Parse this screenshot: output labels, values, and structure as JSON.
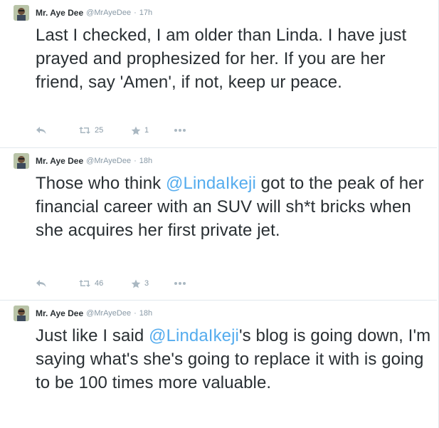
{
  "tweets": [
    {
      "author": {
        "name": "Mr. Aye Dee",
        "handle": "@MrAyeDee"
      },
      "separator": "·",
      "time": "17h",
      "text": "Last I checked, I am older than Linda. I have just prayed and prophesized for her. If you are her friend, say 'Amen', if not, keep ur peace.",
      "retweets": "25",
      "favorites": "1"
    },
    {
      "author": {
        "name": "Mr. Aye Dee",
        "handle": "@MrAyeDee"
      },
      "separator": "·",
      "time": "18h",
      "text_before": "Those who think ",
      "mention": "@LindaIkeji",
      "text_after": " got to the peak of her financial career with an SUV will sh*t bricks when she acquires her first private jet.",
      "retweets": "46",
      "favorites": "3"
    },
    {
      "author": {
        "name": "Mr. Aye Dee",
        "handle": "@MrAyeDee"
      },
      "separator": "·",
      "time": "18h",
      "text_before": "Just like I said ",
      "mention": "@LindaIkeji",
      "text_after": "'s blog is going down, I'm saying what's she's going to replace it with is going to be 100 times more valuable."
    }
  ],
  "colors": {
    "text": "#292f33",
    "muted": "#8899a6",
    "link": "#55acee",
    "icon": "#aab8c2",
    "divider": "#e1e8ed"
  },
  "icons": [
    "avatar",
    "reply-icon",
    "retweet-icon",
    "favorite-icon",
    "more-icon"
  ]
}
